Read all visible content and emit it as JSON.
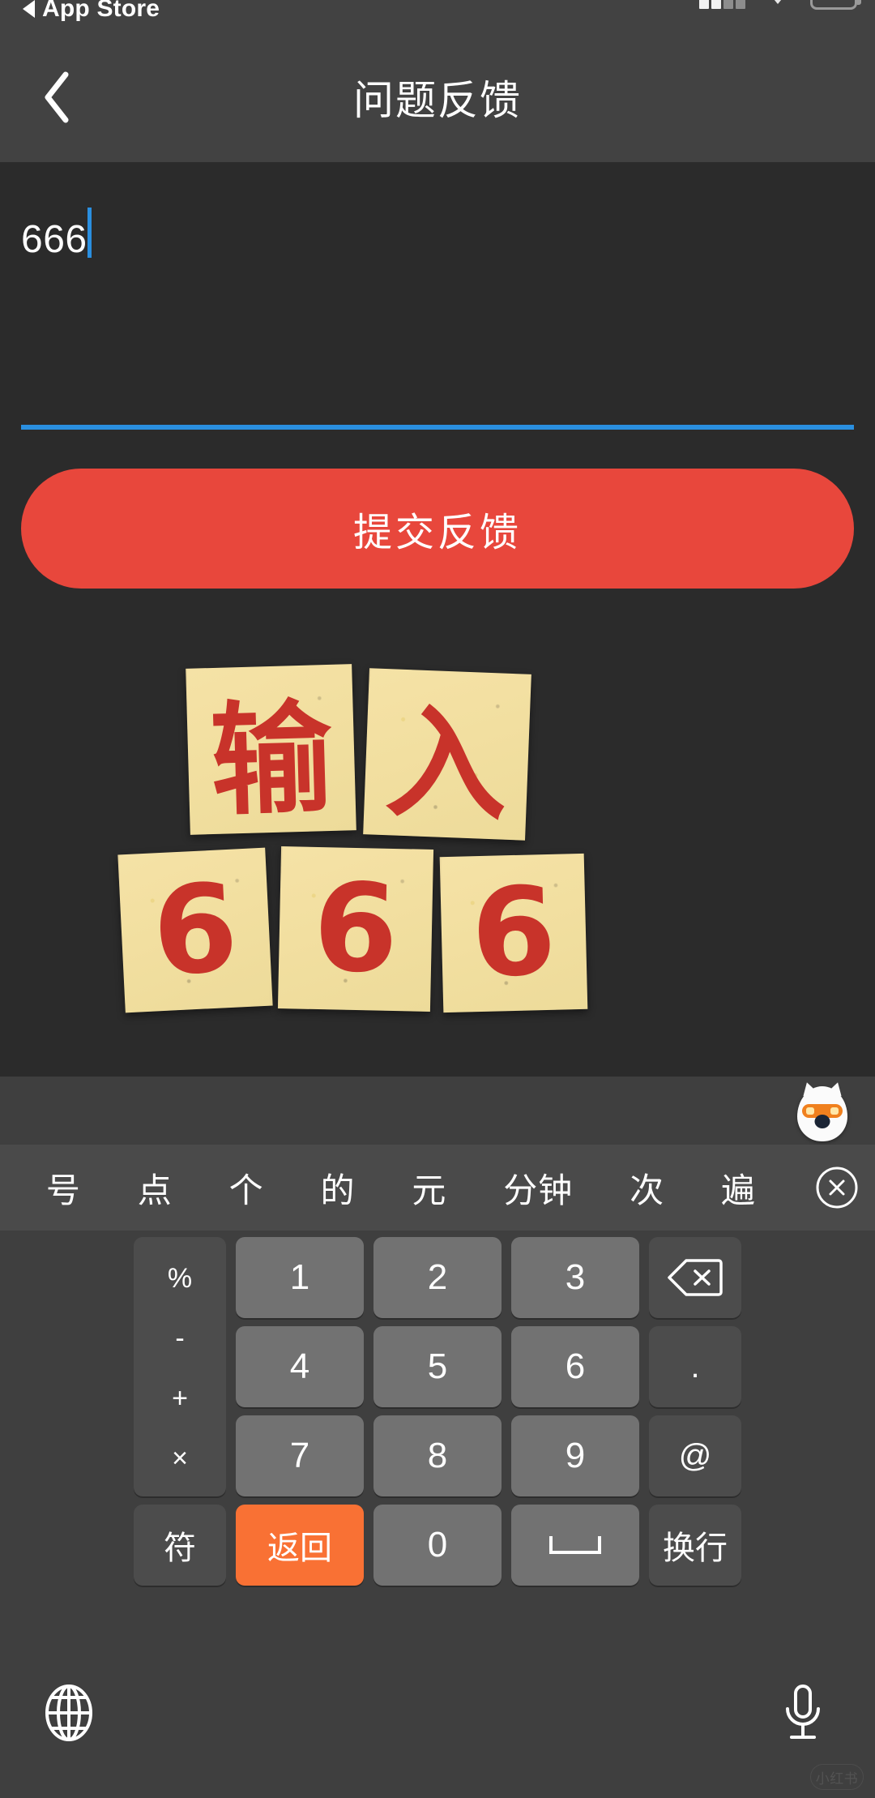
{
  "status_bar": {
    "back_app_label": "App Store",
    "back_icon": "left-triangle-icon",
    "signal_icon": "cellular-signal-icon",
    "wifi_icon": "wifi-icon",
    "battery_icon": "battery-icon"
  },
  "nav": {
    "back_icon": "chevron-left-icon",
    "title": "问题反馈"
  },
  "form": {
    "input_value": "666",
    "input_placeholder": "",
    "submit_label": "提交反馈",
    "accent_underline": "#2a8fe0",
    "submit_color": "#e8473c"
  },
  "illustration": {
    "name": "input-666-paper-cards",
    "top_cards": [
      "输",
      "入"
    ],
    "bottom_cards": [
      "6",
      "6",
      "6"
    ],
    "card_color": "#f2dfa0",
    "glyph_color": "#c8332a"
  },
  "keyboard": {
    "mascot_icon": "sogou-mascot-icon",
    "suggestions": [
      "号",
      "点",
      "个",
      "的",
      "元",
      "分钟",
      "次",
      "遍"
    ],
    "suggest_close_icon": "close-circle-icon",
    "ops_column": [
      "%",
      "-",
      "+",
      "×"
    ],
    "rows": [
      [
        {
          "id": "k1",
          "label": "1",
          "type": "num"
        },
        {
          "id": "k2",
          "label": "2",
          "type": "num"
        },
        {
          "id": "k3",
          "label": "3",
          "type": "num"
        },
        {
          "id": "backspace",
          "label": "",
          "type": "fn",
          "icon": "backspace-icon"
        }
      ],
      [
        {
          "id": "k4",
          "label": "4",
          "type": "num"
        },
        {
          "id": "k5",
          "label": "5",
          "type": "num"
        },
        {
          "id": "k6",
          "label": "6",
          "type": "num"
        },
        {
          "id": "dot",
          "label": ".",
          "type": "fn"
        }
      ],
      [
        {
          "id": "k7",
          "label": "7",
          "type": "num"
        },
        {
          "id": "k8",
          "label": "8",
          "type": "num"
        },
        {
          "id": "k9",
          "label": "9",
          "type": "num"
        },
        {
          "id": "at",
          "label": "@",
          "type": "fn"
        }
      ]
    ],
    "bottom_row": {
      "symbols_label": "符",
      "return_label": "返回",
      "zero_label": "0",
      "space_icon": "space-bar-icon",
      "newline_label": "换行",
      "return_color": "#f97134"
    },
    "globe_icon": "globe-icon",
    "mic_icon": "microphone-icon"
  },
  "watermark": {
    "text": "小红书"
  }
}
